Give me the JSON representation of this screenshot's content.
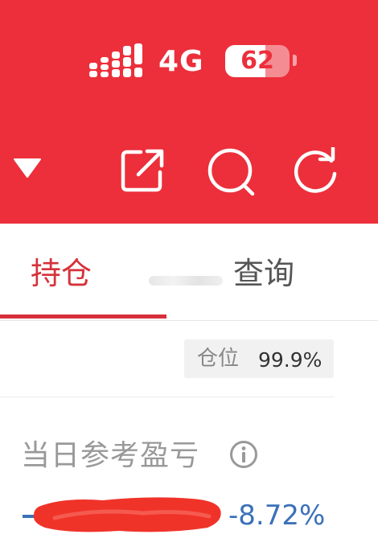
{
  "status_bar": {
    "network": "4G",
    "battery": "62",
    "battery_level": 0.62
  },
  "toolbar": {
    "icons": [
      "dropdown-triangle-icon",
      "share-icon",
      "search-icon",
      "refresh-icon"
    ]
  },
  "tabs": {
    "holdings": "持仓",
    "query": "查询"
  },
  "position": {
    "label": "仓位",
    "value": "99.9%"
  },
  "daily_pl": {
    "label": "当日参考盈亏",
    "percent": "-8.72%"
  },
  "colors": {
    "header_red": "#ec2f3b",
    "active_tab": "#d6313a",
    "loss_blue": "#3b71b8"
  }
}
